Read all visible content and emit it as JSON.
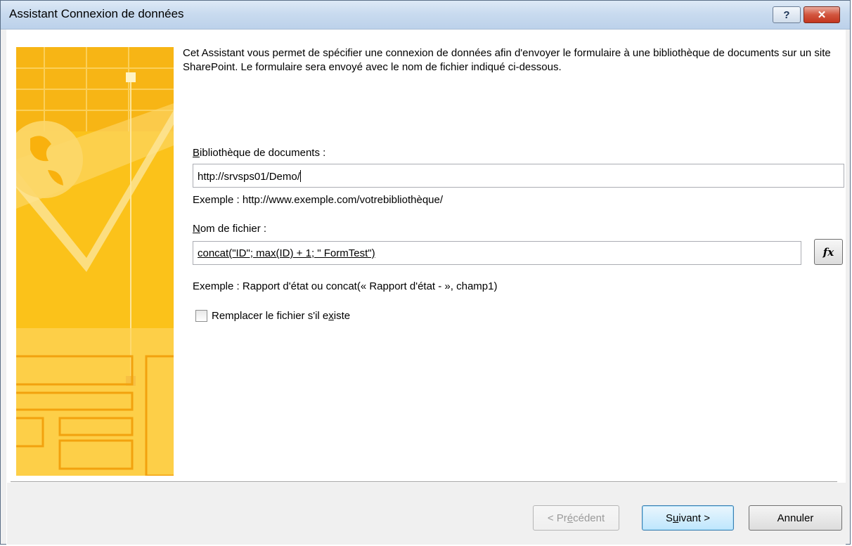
{
  "window": {
    "title": "Assistant Connexion de données",
    "help_glyph": "?",
    "close_glyph": "✕"
  },
  "intro_text": "Cet Assistant vous permet de spécifier une connexion de données afin d'envoyer le formulaire à une bibliothèque de documents sur un site SharePoint. Le formulaire sera envoyé avec le nom de fichier indiqué ci-dessous.",
  "library": {
    "label_mnemonic": "B",
    "label_rest": "ibliothèque de documents :",
    "value": "http://srvsps01/Demo/",
    "example": "Exemple : http://www.exemple.com/votrebibliothèque/"
  },
  "filename": {
    "label_mnemonic": "N",
    "label_rest": "om de fichier :",
    "value": "concat(\"ID\"; max(ID) + 1; \" FormTest\")",
    "example": "Exemple : Rapport d'état ou concat(« Rapport d'état - », champ1)",
    "fx_label": "fx"
  },
  "overwrite": {
    "label_pre": "Remplacer le fichier s'il e",
    "label_mnemonic": "x",
    "label_post": "iste",
    "checked": false
  },
  "buttons": {
    "back_pre": "< Pr",
    "back_mnemonic": "é",
    "back_post": "cédent",
    "next_pre": "S",
    "next_mnemonic": "u",
    "next_post": "ivant >",
    "cancel": "Annuler"
  },
  "colors": {
    "titlebar": "#c9dbef",
    "art_base": "#fbc21a",
    "art_light": "#fde59a",
    "art_dark": "#f2a20e",
    "primary_button": "#bee6fd",
    "close_button": "#c3361f"
  }
}
